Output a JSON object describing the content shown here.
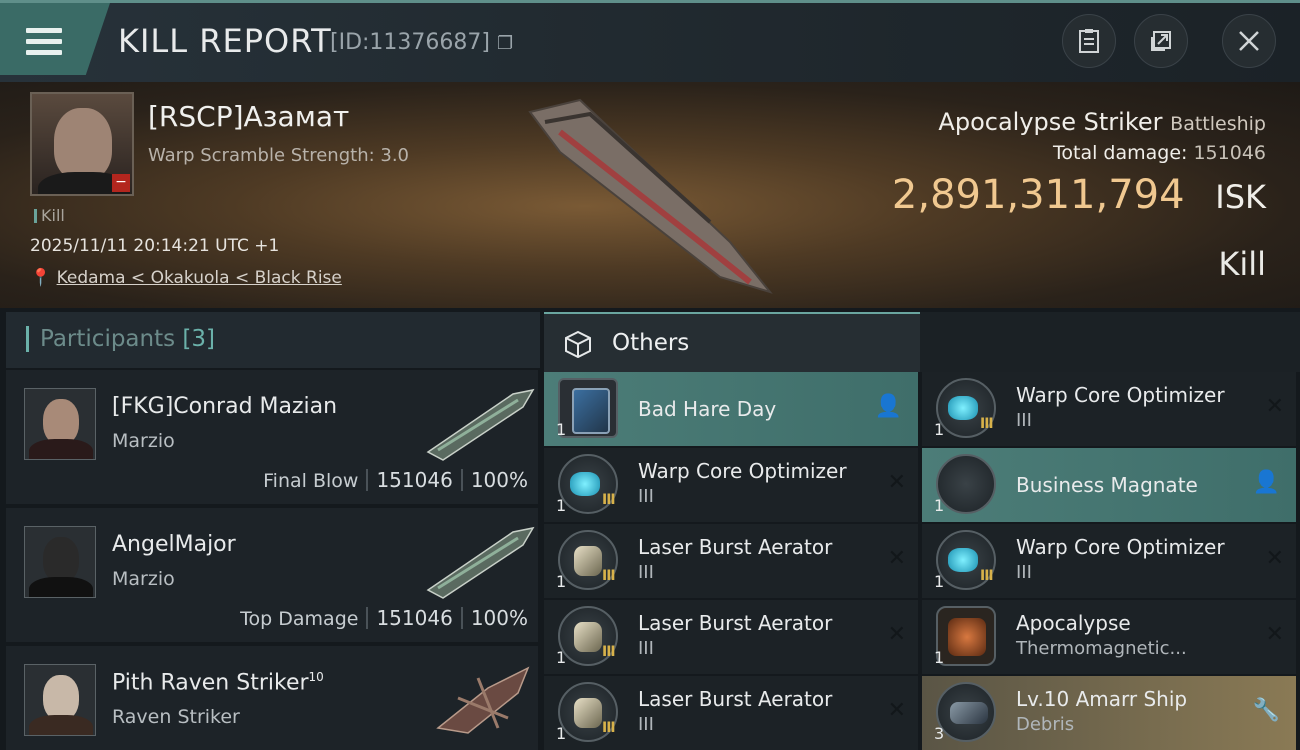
{
  "header": {
    "title": "KILL REPORT",
    "report_id": "[ID:11376687]",
    "icons": [
      "menu-icon",
      "copy-icon",
      "clipboard-icon",
      "share-icon",
      "close-icon"
    ]
  },
  "victim": {
    "name": "[RSCP]Азамат",
    "warp_scramble": "Warp Scramble Strength: 3.0",
    "kill_tag": "Kill",
    "datetime": "2025/11/11 20:14:21 UTC +1",
    "location": "Kedama < Okakuola < Black Rise",
    "ship_name": "Apocalypse Striker",
    "ship_class": "Battleship",
    "total_damage_label": "Total damage:",
    "total_damage_value": "151046",
    "isk_value": "2,891,311,794",
    "isk_unit": "ISK",
    "result": "Kill"
  },
  "participants": {
    "title": "Participants",
    "count": "[3]",
    "items": [
      {
        "name": "[FKG]Conrad Mazian",
        "corp": "Marzio",
        "label": "Final Blow",
        "damage": "151046",
        "percent": "100%"
      },
      {
        "name": "AngelMajor",
        "corp": "Marzio",
        "label": "Top Damage",
        "damage": "151046",
        "percent": "100%"
      },
      {
        "name": "Pith Raven Striker",
        "sup": "10",
        "corp": "Raven Striker"
      }
    ]
  },
  "others": {
    "title": "Others",
    "left": [
      {
        "qty": "1",
        "name": "Bad Hare Day",
        "sub": "",
        "tier": "",
        "style": "hl",
        "icon": "book"
      },
      {
        "qty": "1",
        "name": "Warp Core Optimizer",
        "sub": "III",
        "tier": "III",
        "style": "",
        "icon": "cyan"
      },
      {
        "qty": "1",
        "name": "Laser Burst Aerator",
        "sub": "III",
        "tier": "III",
        "style": "",
        "icon": "metal"
      },
      {
        "qty": "1",
        "name": "Laser Burst Aerator",
        "sub": "III",
        "tier": "III",
        "style": "",
        "icon": "metal"
      },
      {
        "qty": "1",
        "name": "Laser Burst Aerator",
        "sub": "III",
        "tier": "III",
        "style": "",
        "icon": "metal"
      }
    ],
    "right": [
      {
        "qty": "1",
        "name": "Warp Core Optimizer",
        "sub": "III",
        "tier": "III",
        "style": "",
        "icon": "cyan"
      },
      {
        "qty": "1",
        "name": "Business Magnate",
        "sub": "",
        "tier": "",
        "style": "hl",
        "icon": "book2"
      },
      {
        "qty": "1",
        "name": "Warp Core Optimizer",
        "sub": "III",
        "tier": "III",
        "style": "",
        "icon": "cyan"
      },
      {
        "qty": "1",
        "name": "Apocalypse",
        "sub": "Thermomagnetic...",
        "tier": "",
        "style": "",
        "icon": "orange"
      },
      {
        "qty": "3",
        "name": "Lv.10 Amarr Ship",
        "sub": "Debris",
        "tier": "",
        "style": "gold",
        "icon": "debris"
      }
    ]
  },
  "colors": {
    "accent": "#6bb1aa",
    "isk": "#f0c890",
    "highlight": "#4c7d78",
    "gold": "#8a7a55"
  }
}
